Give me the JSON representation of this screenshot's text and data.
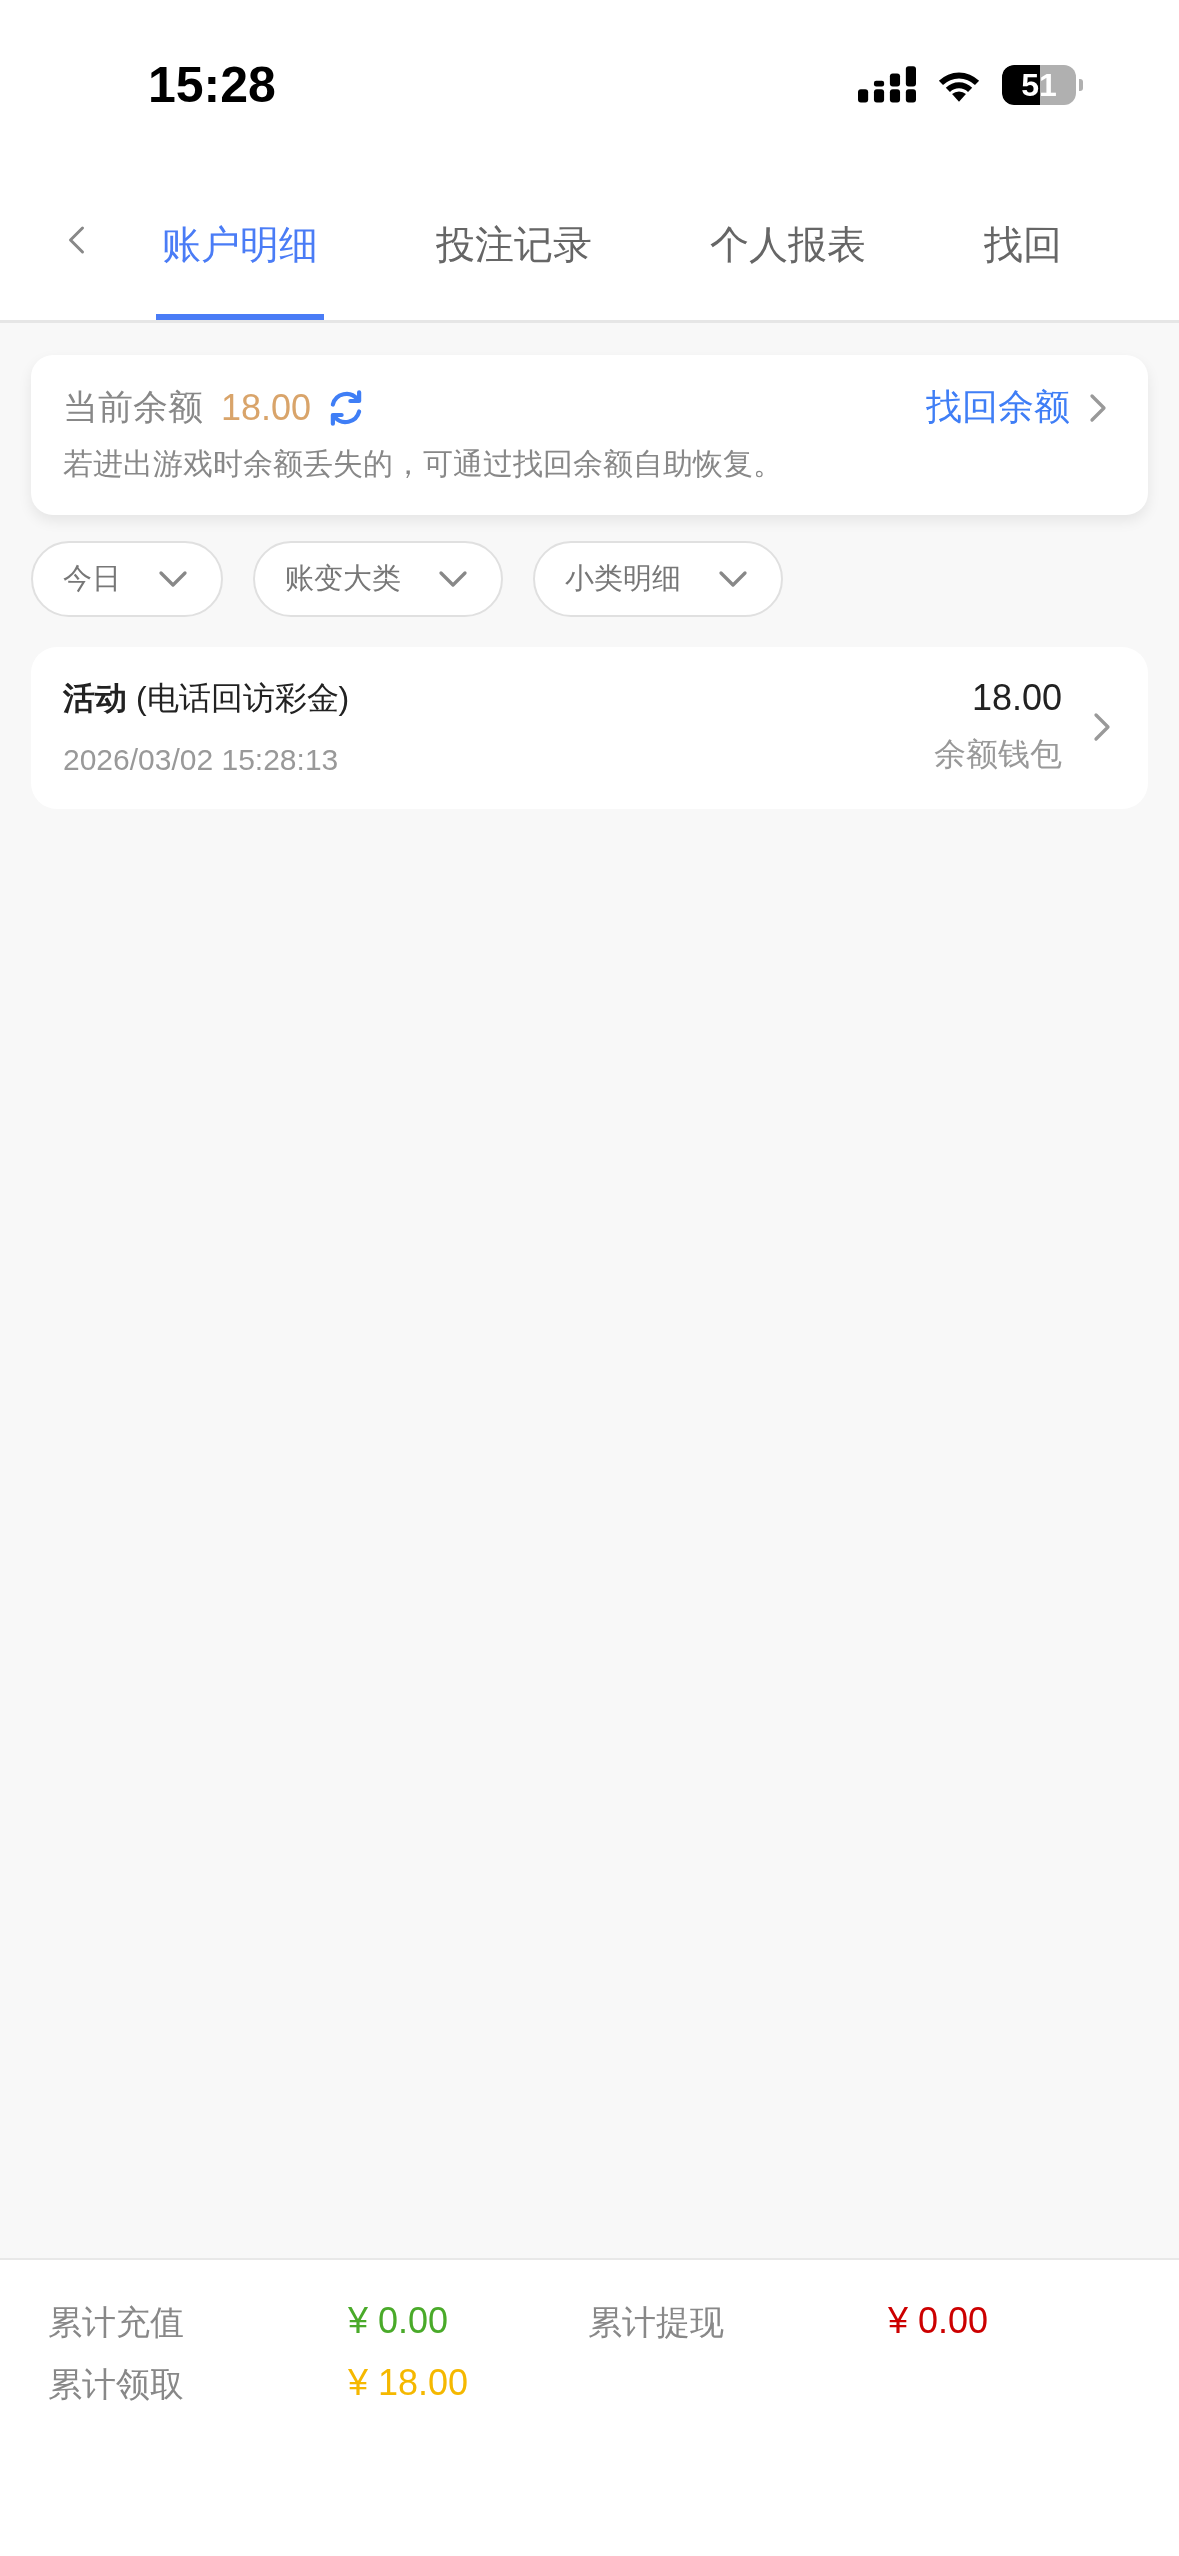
{
  "status_bar": {
    "time": "15:28",
    "battery": "51"
  },
  "tabs": [
    {
      "label": "账户明细",
      "selected": true
    },
    {
      "label": "投注记录",
      "selected": false
    },
    {
      "label": "个人报表",
      "selected": false
    },
    {
      "label": "找回",
      "selected": false
    }
  ],
  "balance_card": {
    "label": "当前余额",
    "amount": "18.00",
    "link": "找回余额",
    "note": "若进出游戏时余额丢失的，可通过找回余额自助恢复。"
  },
  "filters": [
    {
      "label": "今日"
    },
    {
      "label": "账变大类"
    },
    {
      "label": "小类明细"
    }
  ],
  "records": [
    {
      "title": "**活动** (电话回访彩金)",
      "time": "2026/03/02 15:28:13",
      "amount": "18.00",
      "wallet": "余额钱包"
    }
  ],
  "totals": [
    {
      "label": "累计充值",
      "value": "¥ 0.00",
      "color": "#4aaa2a"
    },
    {
      "label": "累计提现",
      "value": "¥ 0.00",
      "color": "#cc0000"
    },
    {
      "label": "累计领取",
      "value": "¥ 18.00",
      "color": "#f5b800"
    }
  ]
}
